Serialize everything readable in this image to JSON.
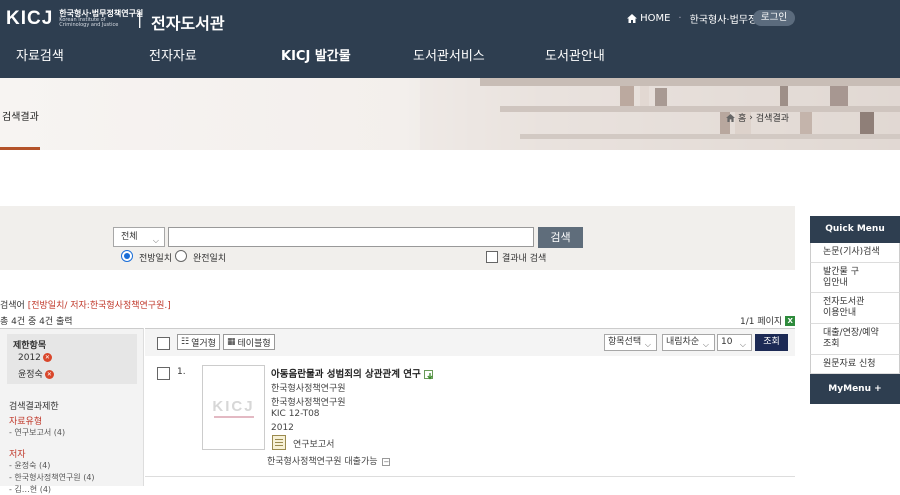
{
  "header": {
    "logo_mark": "KICJ",
    "logo_ko": "한국형사·법무정책연구원",
    "logo_en_1": "Korean Institute of",
    "logo_en_2": "Criminology and Justice",
    "separator": "|",
    "site_title": "전자도서관",
    "home": "HOME",
    "org": "한국형사·법무정책연구원",
    "login": "로그인",
    "nav": [
      "자료검색",
      "전자자료",
      "KICJ 발간물",
      "도서관서비스",
      "도서관안내"
    ]
  },
  "banner": {
    "title": "검색결과",
    "breadcrumb_home": "홈",
    "breadcrumb_current": "검색결과"
  },
  "search": {
    "scope_selected": "전체",
    "query_value": "",
    "search_button": "검색",
    "match_front": "전방일치",
    "match_exact": "완전일치",
    "within_results": "결과내 검색"
  },
  "result_info": {
    "label": "검색어",
    "query": "[전방일치/ 저자:한국형사정책연구원.]",
    "count_text": "총 4건 중 4건 출력",
    "page": "1/1 페이지"
  },
  "facet": {
    "limit_title": "제한항목",
    "limits": [
      "2012",
      "윤정숙"
    ],
    "narrow_title": "검색결과제한",
    "groups": [
      {
        "title": "자료유형",
        "items": [
          "- 연구보고서 (4)"
        ]
      },
      {
        "title": "저자",
        "items": [
          "- 윤정숙 (4)",
          "- 한국형사정책연구원 (4)",
          "- 김…현 (4)"
        ]
      }
    ]
  },
  "toolbar": {
    "list_view": "열거형",
    "table_view": "테이블형",
    "field_select": "항목선택",
    "sort_select": "내림차순",
    "per_page": "10",
    "go_button": "조회"
  },
  "results": [
    {
      "num": "1.",
      "thumb_mark": "KICJ",
      "title": "아동음란물과 성범죄의 상관관계 연구",
      "author": "한국형사정책연구원",
      "publisher": "한국형사정책연구원",
      "call_no": "KIC 12-T08",
      "year": "2012",
      "type": "연구보고서",
      "holding": "한국형사정책연구원 대출가능"
    }
  ],
  "quick_menu": {
    "title": "Quick Menu",
    "items": [
      "논문(기사)검색",
      "발간물 구입안내",
      "전자도서관 이용안내",
      "대출/연장/예약 조회",
      "원문자료 신청"
    ],
    "my_menu": "MyMenu"
  }
}
